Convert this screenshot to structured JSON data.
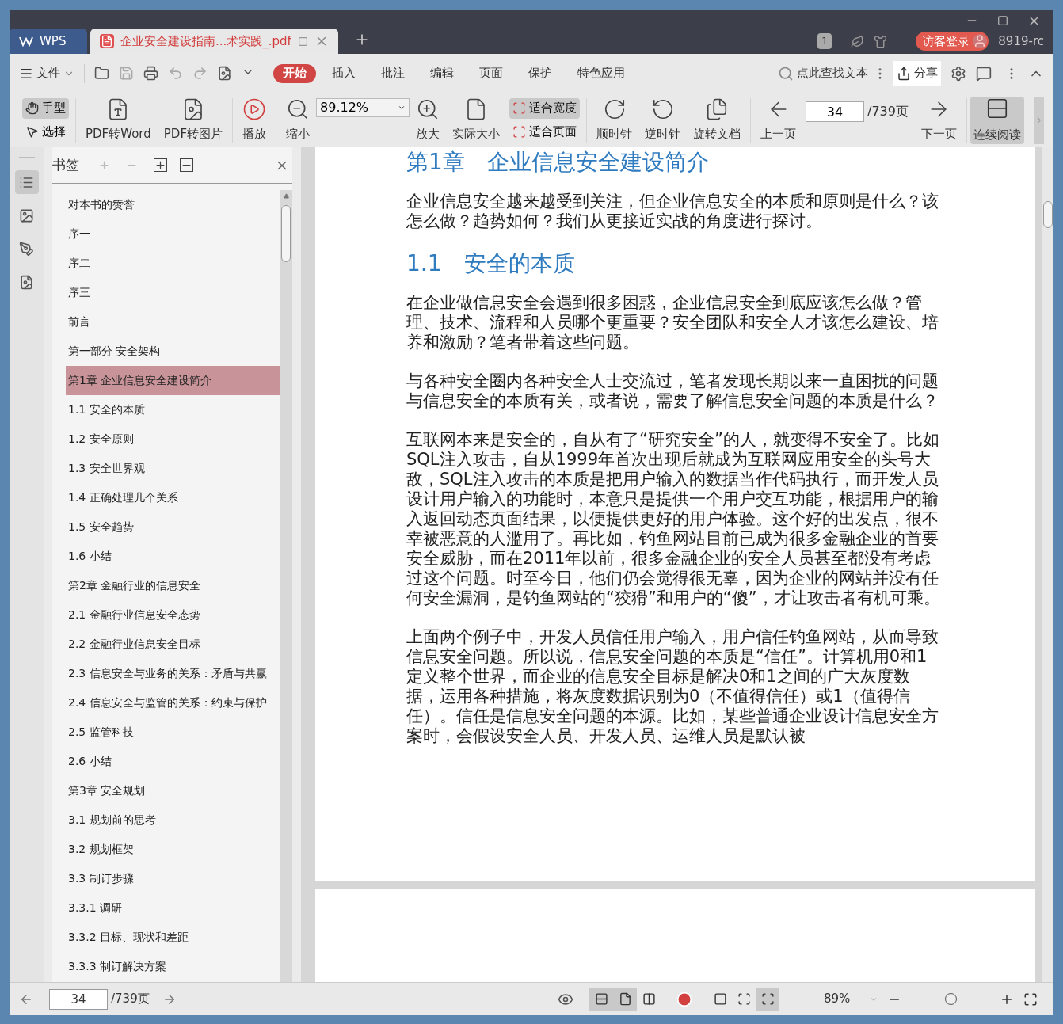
{
  "title_bar": {
    "tabs": [
      {
        "label": "WPS",
        "kind": "home",
        "selected": false
      },
      {
        "label": "企业安全建设指南...术实践_.pdf",
        "kind": "doc",
        "selected": true
      }
    ],
    "badge": "1",
    "login": "访客登录",
    "user": "8919-rc"
  },
  "menu_bar": {
    "file": "文件",
    "tabs": [
      {
        "label": "开始",
        "selected": true
      },
      {
        "label": "插入",
        "selected": false
      },
      {
        "label": "批注",
        "selected": false
      },
      {
        "label": "编辑",
        "selected": false
      },
      {
        "label": "页面",
        "selected": false
      },
      {
        "label": "保护",
        "selected": false
      },
      {
        "label": "特色应用",
        "selected": false
      }
    ],
    "search": {
      "placeholder": "点此查找文本"
    },
    "share": "分享"
  },
  "toolbar": {
    "tools": [
      {
        "kind": "stack",
        "items": [
          {
            "label": "手型",
            "selected": true
          },
          {
            "label": "选择",
            "selected": false
          }
        ]
      },
      {
        "kind": "big",
        "label": "PDF转Word"
      },
      {
        "kind": "big",
        "label": "PDF转图片"
      },
      {
        "kind": "big",
        "label": "播放"
      },
      {
        "kind": "big",
        "label": "缩小"
      },
      {
        "kind": "zoom",
        "value": "89.12%"
      },
      {
        "kind": "big",
        "label": "放大"
      },
      {
        "kind": "big",
        "label": "实际大小"
      },
      {
        "kind": "stack",
        "items": [
          {
            "label": "适合宽度",
            "selected": true
          },
          {
            "label": "适合页面",
            "selected": false
          }
        ]
      },
      {
        "kind": "big",
        "label": "顺时针"
      },
      {
        "kind": "big",
        "label": "逆时针"
      },
      {
        "kind": "big",
        "label": "旋转文档"
      },
      {
        "kind": "big",
        "label": "上一页"
      },
      {
        "kind": "page",
        "value": "34",
        "total": "/739页"
      },
      {
        "kind": "big",
        "label": "下一页"
      },
      {
        "kind": "toggle",
        "label": "连续阅读",
        "selected": true
      }
    ]
  },
  "side_strip": [
    {
      "selected": true
    },
    {
      "selected": false
    },
    {
      "selected": false
    },
    {
      "selected": false
    }
  ],
  "bookmarks": {
    "title": "书签",
    "items": [
      {
        "label": "对本书的赞誉",
        "selected": false
      },
      {
        "label": "序一",
        "selected": false
      },
      {
        "label": "序二",
        "selected": false
      },
      {
        "label": "序三",
        "selected": false
      },
      {
        "label": "前言",
        "selected": false
      },
      {
        "label": "第一部分 安全架构",
        "selected": false
      },
      {
        "label": "第1章 企业信息安全建设简介",
        "selected": true
      },
      {
        "label": "1.1 安全的本质",
        "selected": false
      },
      {
        "label": "1.2 安全原则",
        "selected": false
      },
      {
        "label": "1.3 安全世界观",
        "selected": false
      },
      {
        "label": "1.4 正确处理几个关系",
        "selected": false
      },
      {
        "label": "1.5 安全趋势",
        "selected": false
      },
      {
        "label": "1.6 小结",
        "selected": false
      },
      {
        "label": "第2章 金融行业的信息安全",
        "selected": false
      },
      {
        "label": "2.1 金融行业信息安全态势",
        "selected": false
      },
      {
        "label": "2.2 金融行业信息安全目标",
        "selected": false
      },
      {
        "label": "2.3 信息安全与业务的关系：矛盾与共赢",
        "selected": false
      },
      {
        "label": "2.4 信息安全与监管的关系：约束与保护",
        "selected": false
      },
      {
        "label": "2.5 监管科技",
        "selected": false
      },
      {
        "label": "2.6 小结",
        "selected": false
      },
      {
        "label": "第3章 安全规划",
        "selected": false
      },
      {
        "label": "3.1 规划前的思考",
        "selected": false
      },
      {
        "label": "3.2 规划框架",
        "selected": false
      },
      {
        "label": "3.3 制订步骤",
        "selected": false
      },
      {
        "label": "3.3.1 调研",
        "selected": false
      },
      {
        "label": "3.3.2 目标、现状和差距",
        "selected": false
      },
      {
        "label": "3.3.3 制订解决方案",
        "selected": false
      }
    ]
  },
  "document": {
    "blocks": [
      {
        "kind": "h1",
        "text": "第1章　企业信息安全建设简介"
      },
      {
        "kind": "p",
        "text": "企业信息安全越来越受到关注，但企业信息安全的本质和原则是什么？该怎么做？趋势如何？我们从更接近实战的角度进行探讨。"
      },
      {
        "kind": "h2",
        "text": "1.1　安全的本质"
      },
      {
        "kind": "p",
        "text": "在企业做信息安全会遇到很多困惑，企业信息安全到底应该怎么做？管理、技术、流程和人员哪个更重要？安全团队和安全人才该怎么建设、培养和激励？笔者带着这些问题。"
      },
      {
        "kind": "p",
        "text": "与各种安全圈内各种安全人士交流过，笔者发现长期以来一直困扰的问题与信息安全的本质有关，或者说，需要了解信息安全问题的本质是什么？"
      },
      {
        "kind": "p",
        "text": "互联网本来是安全的，自从有了“研究安全”的人，就变得不安全了。比如SQL注入攻击，自从1999年首次出现后就成为互联网应用安全的头号大敌，SQL注入攻击的本质是把用户输入的数据当作代码执行，而开发人员设计用户输入的功能时，本意只是提供一个用户交互功能，根据用户的输入返回动态页面结果，以便提供更好的用户体验。这个好的出发点，很不幸被恶意的人滥用了。再比如，钓鱼网站目前已成为很多金融企业的首要安全威胁，而在2011年以前，很多金融企业的安全人员甚至都没有考虑过这个问题。时至今日，他们仍会觉得很无辜，因为企业的网站并没有任何安全漏洞，是钓鱼网站的“狡猾”和用户的“傻”，才让攻击者有机可乘。"
      },
      {
        "kind": "p",
        "text": "上面两个例子中，开发人员信任用户输入，用户信任钓鱼网站，从而导致信息安全问题。所以说，信息安全问题的本质是“信任”。计算机用0和1定义整个世界，而企业的信息安全目标是解决0和1之间的广大灰度数据，运用各种措施，将灰度数据识别为0（不值得信任）或1（值得信任）。信任是信息安全问题的本源。比如，某些普通企业设计信息安全方案时，会假设安全人员、开发人员、运维人员是默认被"
      }
    ]
  },
  "status_bar": {
    "page": "34",
    "total": "/739页",
    "views": [
      {
        "selected": true
      },
      {
        "selected": true
      },
      {
        "selected": false
      }
    ],
    "fits": [
      {
        "selected": false
      },
      {
        "selected": false
      },
      {
        "selected": true
      }
    ],
    "zoom": "89%",
    "level": 0.5
  }
}
